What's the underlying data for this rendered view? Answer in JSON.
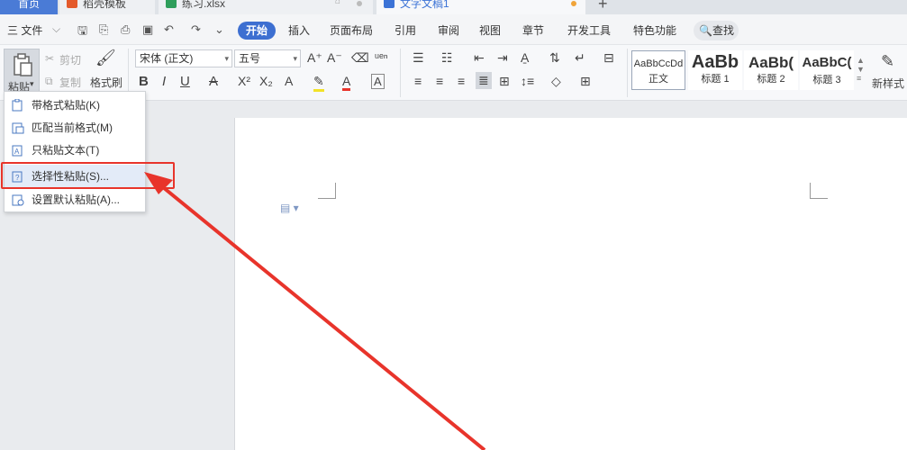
{
  "tabs": {
    "home": "首页",
    "templates": "稻壳模板",
    "xlsx": "练习.xlsx",
    "doc": "文字文稿1",
    "new_tab": "+"
  },
  "menu": {
    "file": "三 文件",
    "items": [
      "开始",
      "插入",
      "页面布局",
      "引用",
      "审阅",
      "视图",
      "章节",
      "开发工具",
      "特色功能"
    ],
    "search": "查找"
  },
  "ribbon": {
    "paste": "粘贴",
    "cut": "剪切",
    "copy": "复制",
    "format_painter": "格式刷",
    "font_name": "宋体 (正文)",
    "font_size": "五号",
    "styles": [
      {
        "preview": "AaBbCcDd",
        "caption": "正文"
      },
      {
        "preview": "AaBb",
        "caption": "标题 1"
      },
      {
        "preview": "AaBb(",
        "caption": "标题 2"
      },
      {
        "preview": "AaBbC(",
        "caption": "标题 3"
      }
    ],
    "new_style": "新样式"
  },
  "paste_menu": {
    "items": [
      {
        "label": "带格式粘贴(K)"
      },
      {
        "label": "匹配当前格式(M)"
      },
      {
        "label": "只粘贴文本(T)"
      },
      {
        "label": "选择性粘贴(S)..."
      },
      {
        "label": "设置默认粘贴(A)..."
      }
    ],
    "highlighted_index": 3
  },
  "colors": {
    "accent": "#3d6fd1",
    "annotation": "#e8342b",
    "xlsx_green": "#2e9e5b",
    "templates_orange": "#e45a2b",
    "doc_blue": "#3c73d6"
  }
}
